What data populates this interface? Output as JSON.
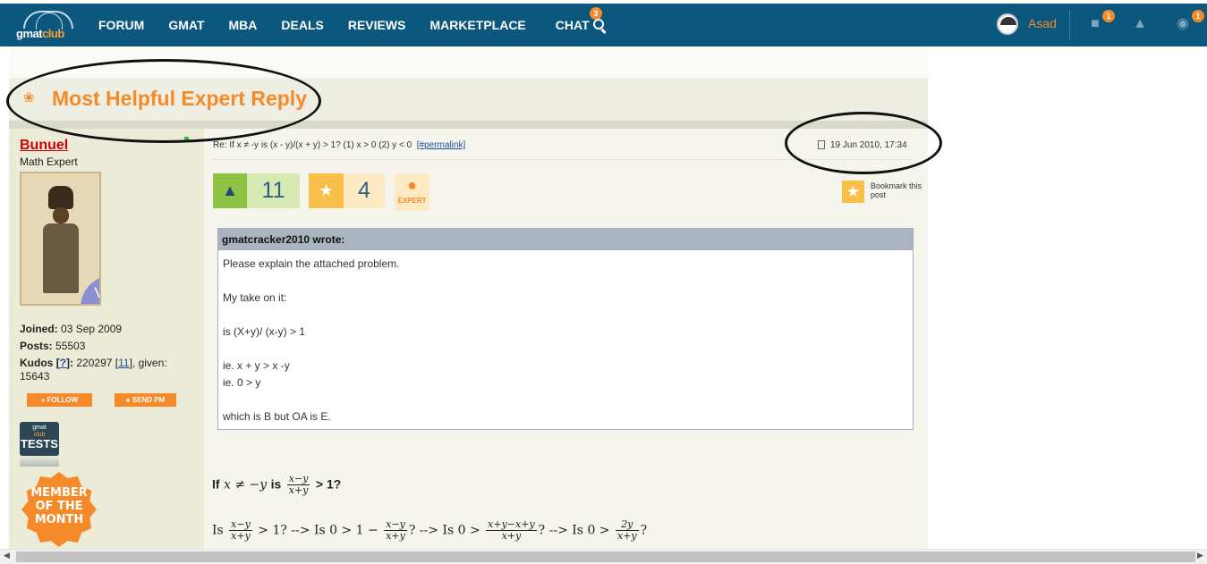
{
  "brand": {
    "logo_text_a": "gmat",
    "logo_text_b": "club"
  },
  "nav": {
    "items": [
      "FORUM",
      "GMAT",
      "MBA",
      "DEALS",
      "REVIEWS",
      "MARKETPLACE",
      "CHAT"
    ],
    "chat_badge": "3"
  },
  "user": {
    "name": "Asad",
    "messages_badge": "1",
    "globe_badge": "1"
  },
  "banner": {
    "title": "Most Helpful Expert Reply"
  },
  "author": {
    "name": "Bunuel",
    "role": "Math Expert",
    "rank_badge": "V",
    "joined_label": "Joined:",
    "joined": "03 Sep 2009",
    "posts_label": "Posts:",
    "posts": "55503",
    "kudos_label": "Kudos",
    "kudos_help": "?",
    "kudos": "220297",
    "kudos_link": "11",
    "given": "given:",
    "given_count": "15643",
    "follow": "FOLLOW",
    "send_pm": "SEND PM",
    "tests_logo": {
      "a": "gmat",
      "b": "club",
      "c": "TESTS"
    },
    "motm": [
      "MEMBER",
      "OF THE",
      "MONTH"
    ]
  },
  "post": {
    "subject": "Re: If x ≠ -y is (x - y)/(x + y) > 1? (1) x > 0 (2) y < 0",
    "permalink": "[#permalink]",
    "date": "19 Jun 2010, 17:34",
    "kudos_count": "11",
    "fav_count": "4",
    "expert_label": "EXPERT",
    "bookmark_label": "Bookmark this post",
    "quote_author": "gmatcracker2010 wrote:",
    "quote_lines": [
      "Please explain the attached problem.",
      "",
      "My take on it:",
      "",
      "is (X+y)/ (x-y) > 1",
      "",
      "ie. x + y > x -y",
      "ie. 0 > y",
      "",
      "which is B but OA is E."
    ],
    "math1": {
      "if": "If",
      "lhs": "x ≠ −y",
      "is": "is",
      "num": "x−y",
      "den": "x+y",
      "rhs": "> 1?"
    },
    "math2": {
      "is1": "Is",
      "n1": "x−y",
      "d1": "x+y",
      "t1": "> 1? --> Is",
      "t2": "0 > 1 −",
      "n2": "x−y",
      "d2": "x+y",
      "t3": "? --> Is",
      "t4": "0 >",
      "n3": "x+y−x+y",
      "d3": "x+y",
      "t5": "? --> Is",
      "t6": "0 >",
      "n4": "2y",
      "d4": "x+y",
      "t7": "?"
    }
  }
}
